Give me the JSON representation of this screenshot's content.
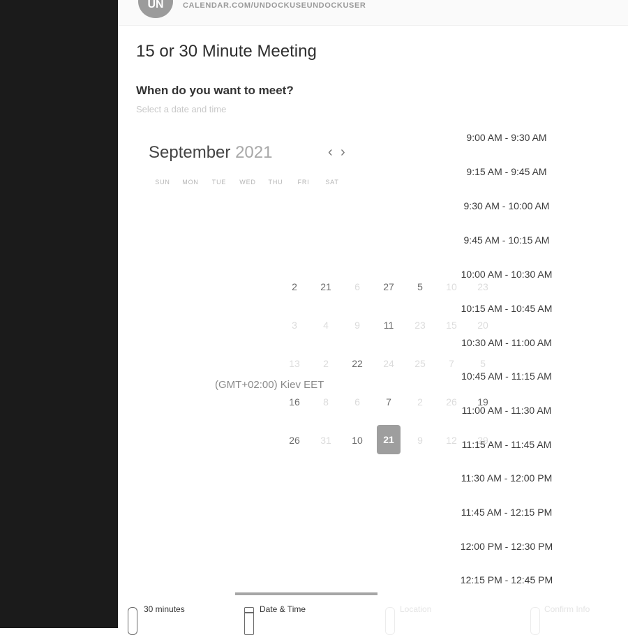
{
  "header": {
    "avatar_initials": "UN",
    "url": "CALENDAR.COM/UNDOCKUSEUNDOCKUSER"
  },
  "page": {
    "title": "15 or 30 Minute Meeting",
    "question": "When do you want to meet?",
    "subhint": "Select a date and time"
  },
  "calendar": {
    "month": "September",
    "year": "2021",
    "prev_icon": "‹",
    "next_icon": "›",
    "weekdays": [
      "SUN",
      "MON",
      "TUE",
      "WED",
      "THU",
      "FRI",
      "SAT"
    ],
    "rows": [
      [
        "2",
        "21",
        "6",
        "27",
        "5",
        "10",
        "23"
      ],
      [
        "3",
        "4",
        "9",
        "11",
        "23",
        "15",
        "20"
      ],
      [
        "13",
        "2",
        "22",
        "24",
        "25",
        "7",
        "5"
      ],
      [
        "16",
        "8",
        "6",
        "7",
        "2",
        "26",
        "19"
      ],
      [
        "26",
        "31",
        "10",
        "21",
        "9",
        "12",
        "29"
      ]
    ],
    "selected_day": "21"
  },
  "timezone": "(GMT+02:00) Kiev EET",
  "time_slots": [
    "9:00 AM - 9:30 AM",
    "9:15 AM - 9:45 AM",
    "9:30 AM - 10:00 AM",
    "9:45 AM - 10:15 AM",
    "10:00 AM - 10:30 AM",
    "10:15 AM - 10:45 AM",
    "10:30 AM - 11:00 AM",
    "10:45 AM - 11:15 AM",
    "11:00 AM - 11:30 AM",
    "11:15 AM - 11:45 AM",
    "11:30 AM - 12:00 PM",
    "11:45 AM - 12:15 PM",
    "12:00 PM - 12:30 PM",
    "12:15 PM - 12:45 PM"
  ],
  "steps": [
    {
      "label": "30 minutes",
      "icon": "clock-icon"
    },
    {
      "label": "Date & Time",
      "icon": "calendar-icon"
    },
    {
      "label": "Location",
      "icon": "location-icon"
    },
    {
      "label": "Confirm Info",
      "icon": "confirm-icon"
    }
  ],
  "progress": {
    "active_step": 2,
    "total_steps": 4
  }
}
